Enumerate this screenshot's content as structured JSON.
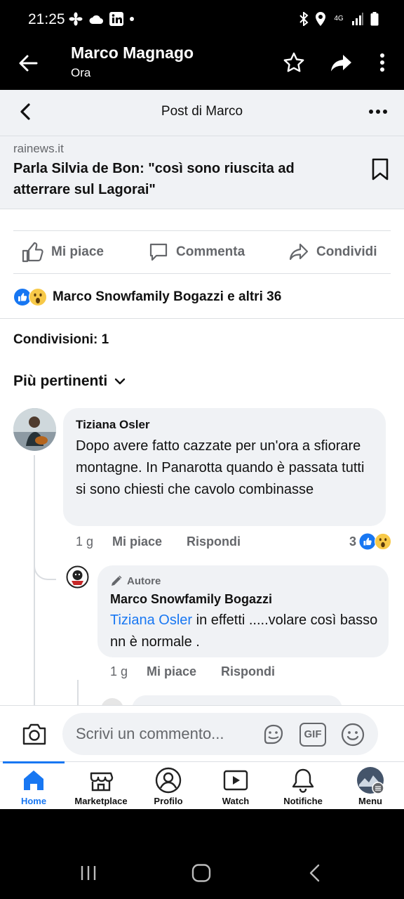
{
  "status_bar": {
    "time": "21:25",
    "left_icons": [
      "fan-icon",
      "cloud-icon",
      "linkedin-icon",
      "dot-icon"
    ],
    "right_icons": [
      "bluetooth-icon",
      "location-icon",
      "network-4g-icon",
      "signal-icon",
      "battery-icon"
    ],
    "network_label": "4G"
  },
  "app_header": {
    "title": "Marco Magnago",
    "subtitle": "Ora"
  },
  "post_topbar": {
    "title": "Post di Marco"
  },
  "link_card": {
    "domain": "rainews.it",
    "title": "Parla Silvia de Bon: \"così sono riuscita ad atterrare sul Lagorai\""
  },
  "actions": {
    "like": "Mi piace",
    "comment": "Commenta",
    "share": "Condividi"
  },
  "reactions": {
    "summary": "Marco Snowfamily Bogazzi e altri 36",
    "types": [
      "like",
      "wow"
    ]
  },
  "shares": {
    "label": "Condivisioni: 1"
  },
  "comments_sort": {
    "label": "Più pertinenti"
  },
  "comments": [
    {
      "author": "Tiziana Osler",
      "text": "Dopo avere fatto cazzate per un'ora a sfiorare montagne.  In Panarotta quando è passata tutti si sono chiesti che cavolo combinasse",
      "time": "1 g",
      "like_label": "Mi piace",
      "reply_label": "Rispondi",
      "reaction_count": "3"
    }
  ],
  "reply": {
    "badge": "Autore",
    "author": "Marco Snowfamily Bogazzi",
    "mention": "Tiziana Osler",
    "text": " in effetti .....volare così basso nn è normale .",
    "time": "1 g",
    "like_label": "Mi piace",
    "reply_label": "Rispondi"
  },
  "composer": {
    "placeholder": "Scrivi un commento...",
    "gif_label": "GIF"
  },
  "tabs": [
    {
      "label": "Home",
      "icon": "home-icon",
      "active": true
    },
    {
      "label": "Marketplace",
      "icon": "marketplace-icon",
      "active": false
    },
    {
      "label": "Profilo",
      "icon": "profile-icon",
      "active": false
    },
    {
      "label": "Watch",
      "icon": "watch-icon",
      "active": false
    },
    {
      "label": "Notifiche",
      "icon": "bell-icon",
      "active": false
    },
    {
      "label": "Menu",
      "icon": "menu-avatar-icon",
      "active": false
    }
  ],
  "colors": {
    "accent": "#1877f2",
    "text": "#111111",
    "secondary_text": "#65676b",
    "bubble": "#f0f2f5"
  }
}
